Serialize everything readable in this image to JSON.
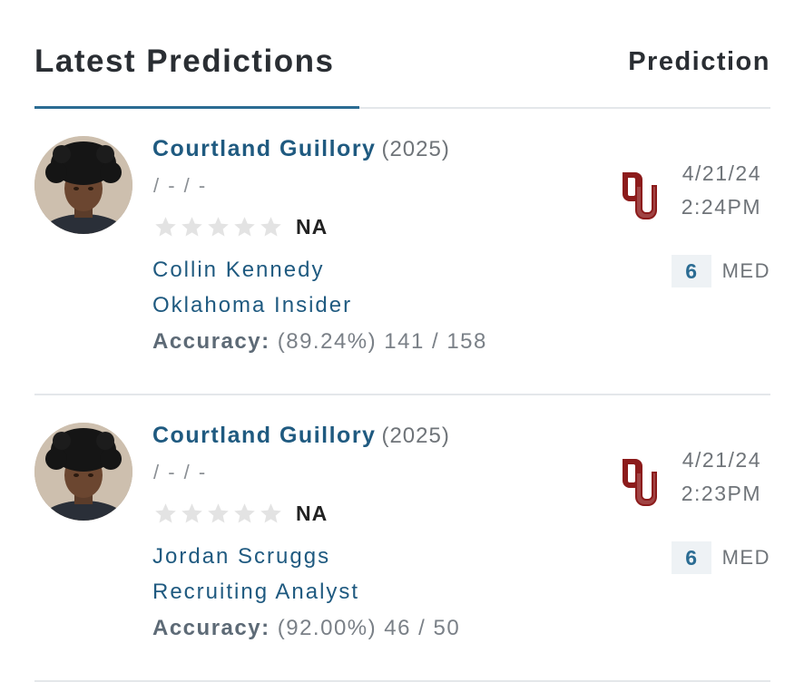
{
  "header": {
    "title": "Latest Predictions",
    "right_label": "Prediction"
  },
  "colors": {
    "accent": "#2b6c93",
    "link": "#1f5a80",
    "ou_crimson": "#8c1b1b",
    "star_empty": "#e3e3e3",
    "divider": "#e4e7ea"
  },
  "predictions": [
    {
      "player_name": "Courtland Guillory",
      "player_year": "(2025)",
      "player_info": "/ - / -",
      "rating": "NA",
      "stars_filled": 0,
      "stars_total": 5,
      "analyst_name": "Collin Kennedy",
      "analyst_title": "Oklahoma Insider",
      "accuracy_label": "Accuracy:",
      "accuracy_value": "(89.24%) 141 / 158",
      "team_logo": "oklahoma-ou-logo",
      "date": "4/21/24",
      "time": "2:24PM",
      "confidence_value": "6",
      "confidence_label": "MED"
    },
    {
      "player_name": "Courtland Guillory",
      "player_year": "(2025)",
      "player_info": "/ - / -",
      "rating": "NA",
      "stars_filled": 0,
      "stars_total": 5,
      "analyst_name": "Jordan Scruggs",
      "analyst_title": "Recruiting Analyst",
      "accuracy_label": "Accuracy:",
      "accuracy_value": "(92.00%) 46 / 50",
      "team_logo": "oklahoma-ou-logo",
      "date": "4/21/24",
      "time": "2:23PM",
      "confidence_value": "6",
      "confidence_label": "MED"
    }
  ]
}
